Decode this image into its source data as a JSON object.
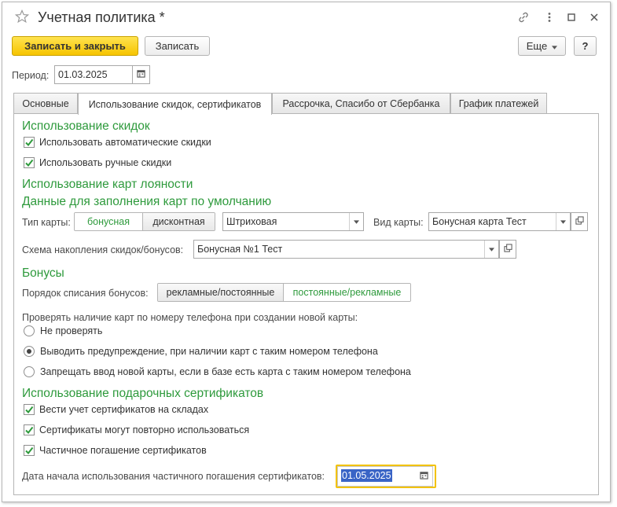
{
  "window": {
    "title": "Учетная политика *",
    "icons": [
      "star-icon",
      "link-icon",
      "more-icon",
      "minimize-icon",
      "close-icon"
    ]
  },
  "toolbar": {
    "save_close_label": "Записать и закрыть",
    "save_label": "Записать",
    "more_label": "Еще",
    "help_label": "?"
  },
  "period": {
    "label": "Период:",
    "value": "01.03.2025"
  },
  "tabs": [
    {
      "label": "Основные",
      "active": false
    },
    {
      "label": "Использование скидок, сертификатов",
      "active": true
    },
    {
      "label": "Рассрочка, Спасибо от Сбербанка",
      "active": false
    },
    {
      "label": "График платежей",
      "active": false
    }
  ],
  "discounts": {
    "heading": "Использование скидок",
    "auto_label": "Использовать автоматические скидки",
    "auto_checked": true,
    "manual_label": "Использовать ручные скидки",
    "manual_checked": true
  },
  "loyalty": {
    "heading": "Использование карт лояности",
    "subheading": "Данные для заполнения карт по умолчанию",
    "card_type_label": "Тип карты:",
    "card_type_options": [
      "бонусная",
      "дисконтная"
    ],
    "card_type_selected": "бонусная",
    "barcode_value": "Штриховая",
    "card_kind_label": "Вид карты:",
    "card_kind_value": "Бонусная карта Тест",
    "scheme_label": "Схема накопления скидок/бонусов:",
    "scheme_value": "Бонусная №1 Тест"
  },
  "bonuses": {
    "heading": "Бонусы",
    "order_label": "Порядок списания бонусов:",
    "order_options": [
      "рекламные/постоянные",
      "постоянные/рекламные"
    ],
    "order_selected": "постоянные/рекламные",
    "phone_check_label": "Проверять наличие карт по номеру телефона при создании новой карты:",
    "radio_options": [
      "Не проверять",
      "Выводить предупреждение, при наличии карт с таким номером телефона",
      "Запрещать ввод новой карты, если в базе есть карта с таким номером телефона"
    ],
    "radio_selected": 1
  },
  "certificates": {
    "heading": "Использование подарочных сертификатов",
    "items": [
      {
        "label": "Вести учет сертификатов на складах",
        "checked": true
      },
      {
        "label": "Сертификаты могут повторно использоваться",
        "checked": true
      },
      {
        "label": "Частичное погашение сертификатов",
        "checked": true
      }
    ],
    "partial_date_label": "Дата начала использования частичного погашения сертификатов:",
    "partial_date_value": "01.05.2025"
  },
  "colors": {
    "accent_green": "#2e9a3c",
    "primary_button": "#f6c400",
    "focus_border": "#f2c200",
    "selection": "#3a64c6"
  }
}
